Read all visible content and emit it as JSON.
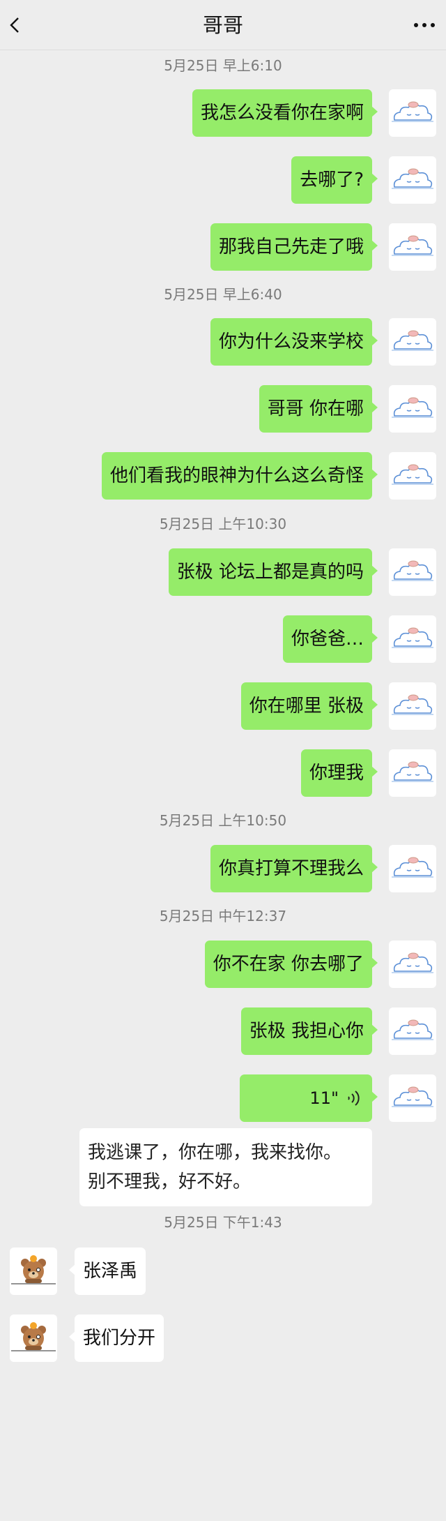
{
  "header": {
    "title": "哥哥",
    "back_icon": "chevron-left-icon",
    "more_icon": "more-dots-icon"
  },
  "chat": {
    "timestamps": [
      "5月25日 早上6:10",
      "5月25日 早上6:40",
      "5月25日 上午10:30",
      "5月25日 上午10:50",
      "5月25日 中午12:37",
      "5月25日 下午1:43"
    ],
    "outgoing": [
      "我怎么没看你在家啊",
      "去哪了?",
      "那我自己先走了哦",
      "你为什么没来学校",
      "哥哥 你在哪",
      "他们看我的眼神为什么这么奇怪",
      "张极 论坛上都是真的吗",
      "你爸爸…",
      "你在哪里 张极",
      "你理我",
      "你真打算不理我么",
      "你不在家 你去哪了",
      "张极 我担心你"
    ],
    "voice": {
      "duration": "11\"",
      "transcript_line1": "我逃课了，你在哪，我来找你。",
      "transcript_line2": "别不理我，好不好。"
    },
    "incoming": [
      "张泽禹",
      "我们分开"
    ],
    "colors": {
      "outgoing_bubble": "#95ec69",
      "incoming_bubble": "#ffffff",
      "background": "#ededed"
    }
  }
}
